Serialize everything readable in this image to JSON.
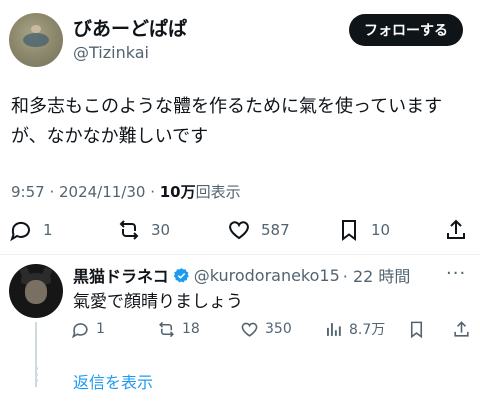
{
  "post": {
    "author_name": "びあーどぱぱ",
    "author_handle": "@Tizinkai",
    "follow_label": "フォローする",
    "text": "和多志もこのような體を作るために氣を使っていますが、なかなか難しいです",
    "time": "9:57 · 2024/11/30 · ",
    "views_count": "10万",
    "views_label": "回表示",
    "replies": "1",
    "reposts": "30",
    "likes": "587",
    "bookmarks": "10"
  },
  "reply": {
    "author_name": "黒猫ドラネコ",
    "author_handle": "@kurodoraneko15",
    "time": "· 22 時間",
    "more": "···",
    "text": "氣愛で顔晴りましょう",
    "replies": "1",
    "reposts": "18",
    "likes": "350",
    "views": "8.7万"
  },
  "show_replies_label": "返信を表示",
  "colors": {
    "accent": "#1d9bf0",
    "text": "#0f1419",
    "muted": "#536471"
  },
  "icons": [
    "reply-icon",
    "repost-icon",
    "like-icon",
    "bookmark-icon",
    "share-icon",
    "views-icon",
    "verified-icon",
    "more-icon"
  ]
}
